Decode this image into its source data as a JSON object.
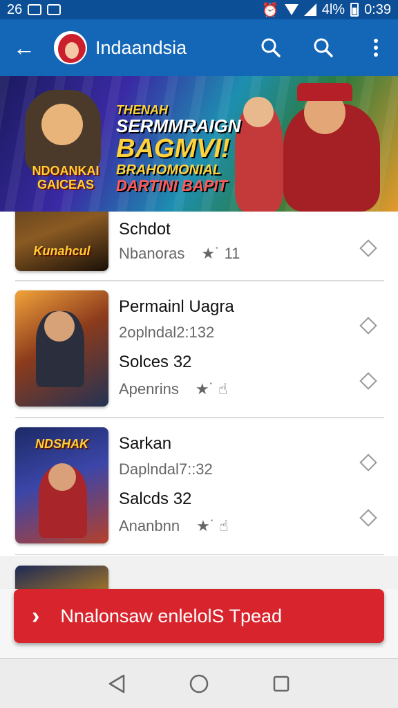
{
  "status_bar": {
    "time_left": "26",
    "battery": "4l%",
    "clock": "0:39"
  },
  "app_bar": {
    "title": "Indaandsia"
  },
  "banner": {
    "line1": "THENAH",
    "line2": "SERMMRAIGN",
    "line3": "BAGMVI!",
    "line4": "BRAHOMONIAL",
    "line5": "DARTINI BAPIT",
    "logo_text": "NDOANKAI GAICEAS"
  },
  "list": [
    {
      "name": "Schdot",
      "lines": [
        "Nbanoras"
      ],
      "rating": "11",
      "thumb_text": "Kunahcul"
    },
    {
      "name": "Permainl Uagra",
      "lines": [
        "2oplndal2:132",
        "Solces 32",
        "Apenrins"
      ],
      "rating": "",
      "thumb_text": ""
    },
    {
      "name": "Sarkan",
      "lines": [
        "Daplndal7::32",
        "Salcds 32",
        "Ananbnn"
      ],
      "rating": "",
      "thumb_text": "NDSHAK"
    }
  ],
  "cta": {
    "label": "Nnalonsaw enlelolS Tpead"
  },
  "colors": {
    "app_bar": "#1466b6",
    "status_bar": "#0d4f97",
    "cta": "#d8252d"
  }
}
